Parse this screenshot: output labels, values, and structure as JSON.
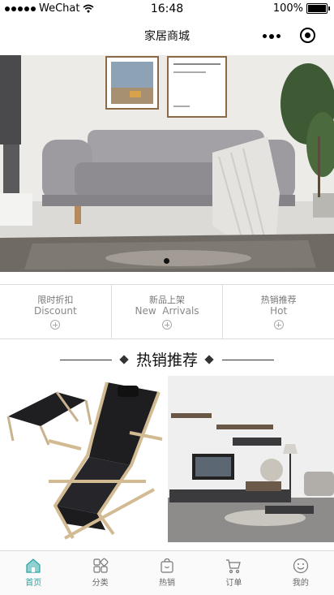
{
  "status_bar": {
    "carrier": "WeChat",
    "time": "16:48",
    "battery": "100%"
  },
  "navbar": {
    "title": "家居商城"
  },
  "banner": {
    "slide_count": 1,
    "active_slide": 1
  },
  "categories": [
    {
      "cn": "限时折扣",
      "en": "Discount"
    },
    {
      "cn": "新品上架",
      "en": "New  Arrivals"
    },
    {
      "cn": "热销推荐",
      "en": "Hot"
    }
  ],
  "section": {
    "title": "热销推荐"
  },
  "tabbar": [
    {
      "label": "首页",
      "icon": "home-icon",
      "active": true
    },
    {
      "label": "分类",
      "icon": "category-icon",
      "active": false
    },
    {
      "label": "热销",
      "icon": "bag-icon",
      "active": false
    },
    {
      "label": "订单",
      "icon": "cart-icon",
      "active": false
    },
    {
      "label": "我的",
      "icon": "smiley-icon",
      "active": false
    }
  ],
  "colors": {
    "accent": "#2aa3a3"
  }
}
